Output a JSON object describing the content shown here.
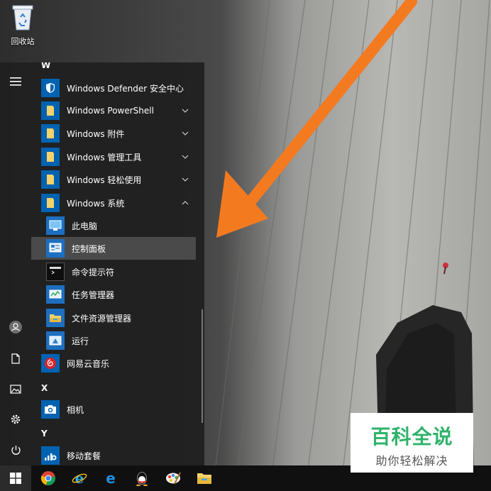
{
  "desktop": {
    "recycle_bin_label": "回收站"
  },
  "watermark": {
    "title": "百科全说",
    "subtitle": "助你轻松解决"
  },
  "start_menu": {
    "sections": [
      {
        "letter": "W"
      },
      {
        "letter": "X"
      },
      {
        "letter": "Y"
      }
    ],
    "items": [
      {
        "label": "Windows Defender 安全中心",
        "icon": "shield-icon",
        "expandable": false
      },
      {
        "label": "Windows PowerShell",
        "icon": "folder-icon",
        "expandable": true,
        "expanded": false
      },
      {
        "label": "Windows 附件",
        "icon": "folder-icon",
        "expandable": true,
        "expanded": false
      },
      {
        "label": "Windows 管理工具",
        "icon": "folder-icon",
        "expandable": true,
        "expanded": false
      },
      {
        "label": "Windows 轻松使用",
        "icon": "folder-icon",
        "expandable": true,
        "expanded": false
      },
      {
        "label": "Windows 系统",
        "icon": "folder-icon",
        "expandable": true,
        "expanded": true
      },
      {
        "label": "此电脑",
        "icon": "computer-icon",
        "sub": true
      },
      {
        "label": "控制面板",
        "icon": "control-panel-icon",
        "sub": true,
        "selected": true
      },
      {
        "label": "命令提示符",
        "icon": "command-prompt-icon",
        "sub": true
      },
      {
        "label": "任务管理器",
        "icon": "task-manager-icon",
        "sub": true
      },
      {
        "label": "文件资源管理器",
        "icon": "file-explorer-icon",
        "sub": true
      },
      {
        "label": "运行",
        "icon": "run-icon",
        "sub": true
      },
      {
        "label": "网易云音乐",
        "icon": "netease-music-icon"
      },
      {
        "label": "相机",
        "icon": "camera-icon"
      },
      {
        "label": "移动套餐",
        "icon": "mobile-plans-icon"
      }
    ],
    "rail": [
      "hamburger-icon",
      "user-icon",
      "document-icon",
      "pictures-icon",
      "settings-icon",
      "power-icon"
    ]
  },
  "taskbar": {
    "apps": [
      "windows-start-icon",
      "chrome-icon",
      "ie-icon",
      "edge-icon",
      "qq-icon",
      "paint-icon",
      "file-explorer-icon"
    ]
  },
  "colors": {
    "menu_bg": "#202020",
    "tile_blue": "#0063b1",
    "folder_yellow": "#f3d26b",
    "arrow_orange": "#f47a20",
    "watermark_green": "#2fb36b"
  }
}
